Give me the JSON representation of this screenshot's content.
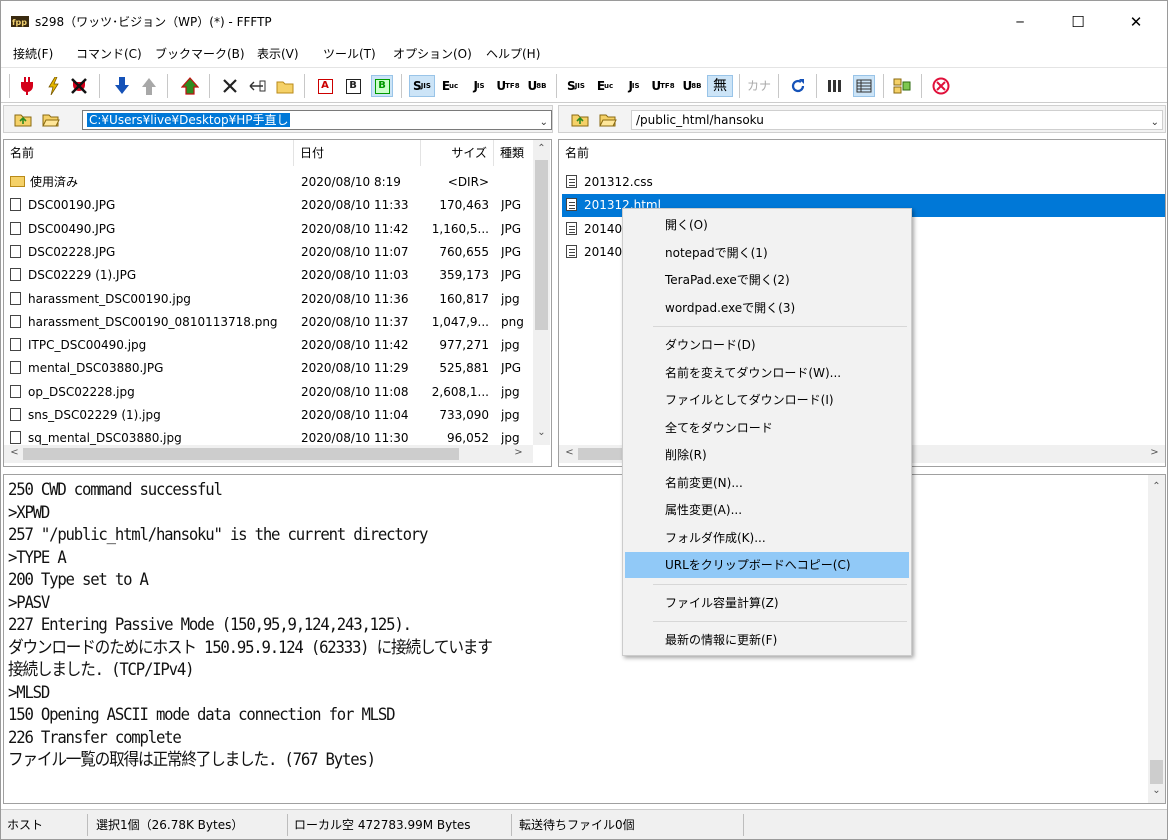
{
  "window": {
    "title": "s298（ワッツ･ビジョン（WP）(*) - FFFTP",
    "minimize_glyph": "─",
    "maximize_glyph": "☐",
    "close_glyph": "✕"
  },
  "menu": [
    "接続(F)",
    "コマンド(C)",
    "ブックマーク(B)",
    "表示(V)",
    "ツール(T)",
    "オプション(O)",
    "ヘルプ(H)"
  ],
  "toolbar": {
    "icons": [
      "connect-icon",
      "quick-connect-icon",
      "disconnect-icon",
      "download-icon",
      "upload-icon",
      "mirror-upload-icon",
      "delete-icon",
      "rename-icon",
      "mkdir-icon",
      "ascii-mode-icon",
      "binary-mode-icon",
      "auto-mode-icon",
      "local-sjis-icon",
      "local-euc-icon",
      "local-jis-icon",
      "local-utf8-icon",
      "local-utf8bom-icon",
      "remote-sjis-icon",
      "remote-euc-icon",
      "remote-jis-icon",
      "remote-utf8-icon",
      "remote-utf8bom-icon",
      "no-conversion-icon",
      "kana-conversion-icon",
      "refresh-icon",
      "list-view-icon",
      "detail-view-icon",
      "sync-folder-icon",
      "stop-icon"
    ],
    "labels": {
      "ascii": "A",
      "binary": "B",
      "sjis": "S",
      "euc": "E",
      "jis": "J",
      "utf": "U",
      "no_conv": "無",
      "kana": "カナ"
    },
    "subs": {
      "sjis": "JIS",
      "euc": "uc",
      "jis": "IS",
      "utf8": "TF8",
      "utf8bom": "8B"
    },
    "colors": {
      "connect": "#d4001a",
      "download": "#1552b8",
      "upload": "#2e8b20",
      "stop": "#e0103a"
    }
  },
  "local": {
    "path": "C:¥Users¥live¥Desktop¥HP手直し",
    "columns": [
      "名前",
      "日付",
      "サイズ",
      "種類"
    ],
    "files": [
      {
        "name": "使用済み",
        "date": "2020/08/10  8:19",
        "size": "<DIR>",
        "type": "",
        "kind": "folder"
      },
      {
        "name": "DSC00190.JPG",
        "date": "2020/08/10 11:33",
        "size": "170,463",
        "type": "JPG",
        "kind": "file"
      },
      {
        "name": "DSC00490.JPG",
        "date": "2020/08/10 11:42",
        "size": "1,160,5...",
        "type": "JPG",
        "kind": "file"
      },
      {
        "name": "DSC02228.JPG",
        "date": "2020/08/10 11:07",
        "size": "760,655",
        "type": "JPG",
        "kind": "file"
      },
      {
        "name": "DSC02229 (1).JPG",
        "date": "2020/08/10 11:03",
        "size": "359,173",
        "type": "JPG",
        "kind": "file"
      },
      {
        "name": "harassment_DSC00190.jpg",
        "date": "2020/08/10 11:36",
        "size": "160,817",
        "type": "jpg",
        "kind": "file"
      },
      {
        "name": "harassment_DSC00190_0810113718.png",
        "date": "2020/08/10 11:37",
        "size": "1,047,9...",
        "type": "png",
        "kind": "file"
      },
      {
        "name": "ITPC_DSC00490.jpg",
        "date": "2020/08/10 11:42",
        "size": "977,271",
        "type": "jpg",
        "kind": "file"
      },
      {
        "name": "mental_DSC03880.JPG",
        "date": "2020/08/10 11:29",
        "size": "525,881",
        "type": "JPG",
        "kind": "file"
      },
      {
        "name": "op_DSC02228.jpg",
        "date": "2020/08/10 11:08",
        "size": "2,608,1...",
        "type": "jpg",
        "kind": "file"
      },
      {
        "name": "sns_DSC02229 (1).jpg",
        "date": "2020/08/10 11:04",
        "size": "733,090",
        "type": "jpg",
        "kind": "file"
      },
      {
        "name": "sq_mental_DSC03880.jpg",
        "date": "2020/08/10 11:30",
        "size": "96,052",
        "type": "jpg",
        "kind": "file"
      }
    ]
  },
  "remote": {
    "path": "/public_html/hansoku",
    "columns": [
      "名前"
    ],
    "files": [
      {
        "name": "201312.css",
        "selected": false
      },
      {
        "name": "201312.html",
        "selected": true
      },
      {
        "name": "20140",
        "selected": false
      },
      {
        "name": "20140",
        "selected": false
      }
    ]
  },
  "context_menu": {
    "items": [
      {
        "label": "開く(O)",
        "group": 0
      },
      {
        "label": "notepadで開く(1)",
        "group": 0
      },
      {
        "label": "TeraPad.exeで開く(2)",
        "group": 0
      },
      {
        "label": "wordpad.exeで開く(3)",
        "group": 0
      },
      {
        "label": "ダウンロード(D)",
        "group": 1
      },
      {
        "label": "名前を変えてダウンロード(W)...",
        "group": 1
      },
      {
        "label": "ファイルとしてダウンロード(I)",
        "group": 1
      },
      {
        "label": "全てをダウンロード",
        "group": 1
      },
      {
        "label": "削除(R)",
        "group": 1
      },
      {
        "label": "名前変更(N)...",
        "group": 1
      },
      {
        "label": "属性変更(A)...",
        "group": 1
      },
      {
        "label": "フォルダ作成(K)...",
        "group": 1
      },
      {
        "label": "URLをクリップボードへコピー(C)",
        "group": 1,
        "highlighted": true
      },
      {
        "label": "ファイル容量計算(Z)",
        "group": 2
      },
      {
        "label": "最新の情報に更新(F)",
        "group": 3
      }
    ]
  },
  "log": [
    "250 CWD command successful",
    ">XPWD",
    "257 \"/public_html/hansoku\" is the current directory",
    ">TYPE A",
    "200 Type set to A",
    ">PASV",
    "227 Entering Passive Mode (150,95,9,124,243,125).",
    "ダウンロードのためにホスト 150.95.9.124 (62333) に接続しています",
    "接続しました. (TCP/IPv4)",
    ">MLSD",
    "150 Opening ASCII mode data connection for MLSD",
    "226 Transfer complete",
    "ファイル一覧の取得は正常終了しました. (767 Bytes)"
  ],
  "status": {
    "host": "ホスト",
    "selection": "選択1個（26.78K Bytes）",
    "local_free": "ローカル空 472783.99M Bytes",
    "queue": "転送待ちファイル0個"
  },
  "glyphs": {
    "up": "⌃",
    "down": "⌄",
    "left": "<",
    "right": ">",
    "combo": "﹀"
  }
}
